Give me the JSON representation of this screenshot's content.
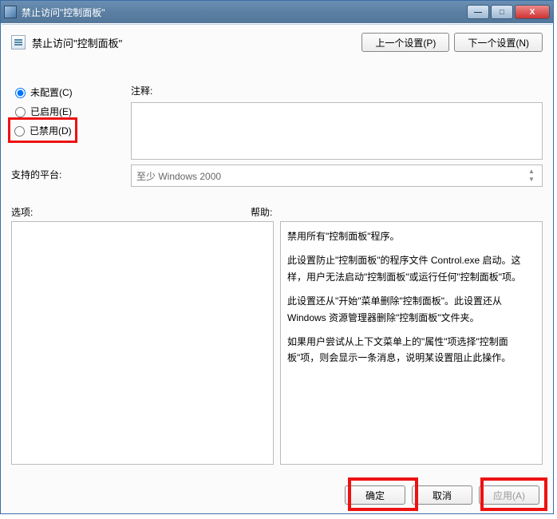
{
  "window": {
    "title": "禁止访问\"控制面板\""
  },
  "controls": {
    "min": "—",
    "max": "□",
    "close": "X"
  },
  "header": {
    "setting_title": "禁止访问\"控制面板\"",
    "prev": "上一个设置(P)",
    "next": "下一个设置(N)"
  },
  "state": {
    "not_configured": "未配置(C)",
    "enabled": "已启用(E)",
    "disabled": "已禁用(D)",
    "selected": "not_configured"
  },
  "labels": {
    "comment": "注释:",
    "platform": "支持的平台:",
    "options": "选项:",
    "help": "帮助:"
  },
  "comment_value": "",
  "platform_value": "至少 Windows 2000",
  "help_text": [
    "禁用所有\"控制面板\"程序。",
    "此设置防止\"控制面板\"的程序文件 Control.exe 启动。这样，用户无法启动\"控制面板\"或运行任何\"控制面板\"项。",
    "此设置还从\"开始\"菜单删除\"控制面板\"。此设置还从 Windows 资源管理器删除\"控制面板\"文件夹。",
    "如果用户尝试从上下文菜单上的\"属性\"项选择\"控制面板\"项，则会显示一条消息，说明某设置阻止此操作。"
  ],
  "buttons": {
    "ok": "确定",
    "cancel": "取消",
    "apply": "应用(A)"
  }
}
